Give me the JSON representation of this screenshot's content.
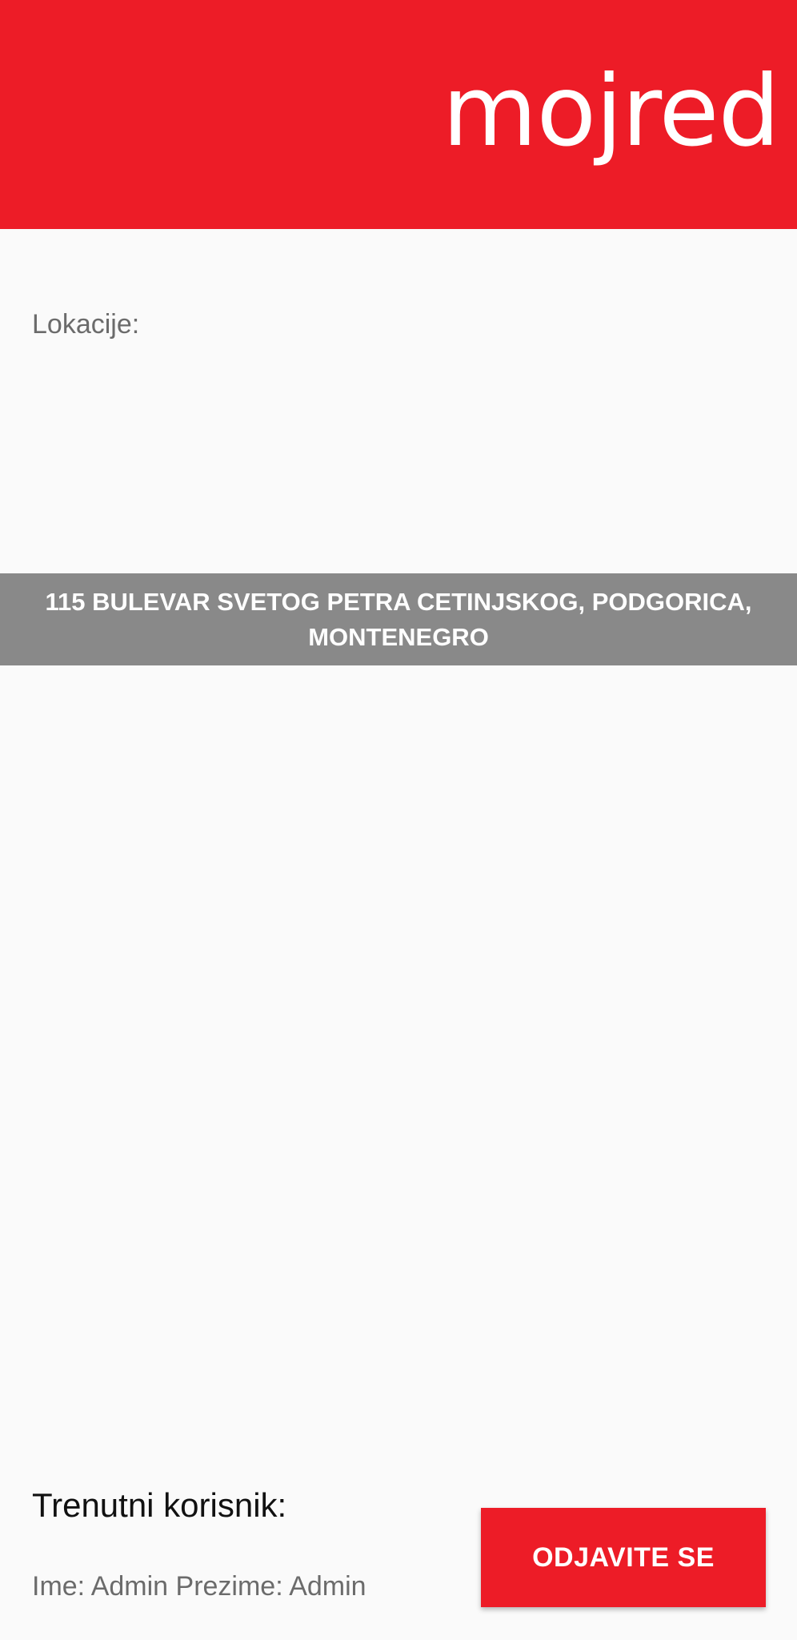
{
  "header": {
    "logo_text": "mojred",
    "background_color": "#ed1c27"
  },
  "locations": {
    "label": "Lokacije:",
    "items": [
      {
        "address": "115 BULEVAR SVETOG PETRA CETINJSKOG, PODGORICA, MONTENEGRO"
      }
    ],
    "item_background_color": "#898989"
  },
  "current_user": {
    "heading": "Trenutni korisnik:",
    "info": "Ime: Admin Prezime: Admin"
  },
  "logout_button": {
    "label": "ODJAVITE SE",
    "color": "#ed1c27"
  }
}
